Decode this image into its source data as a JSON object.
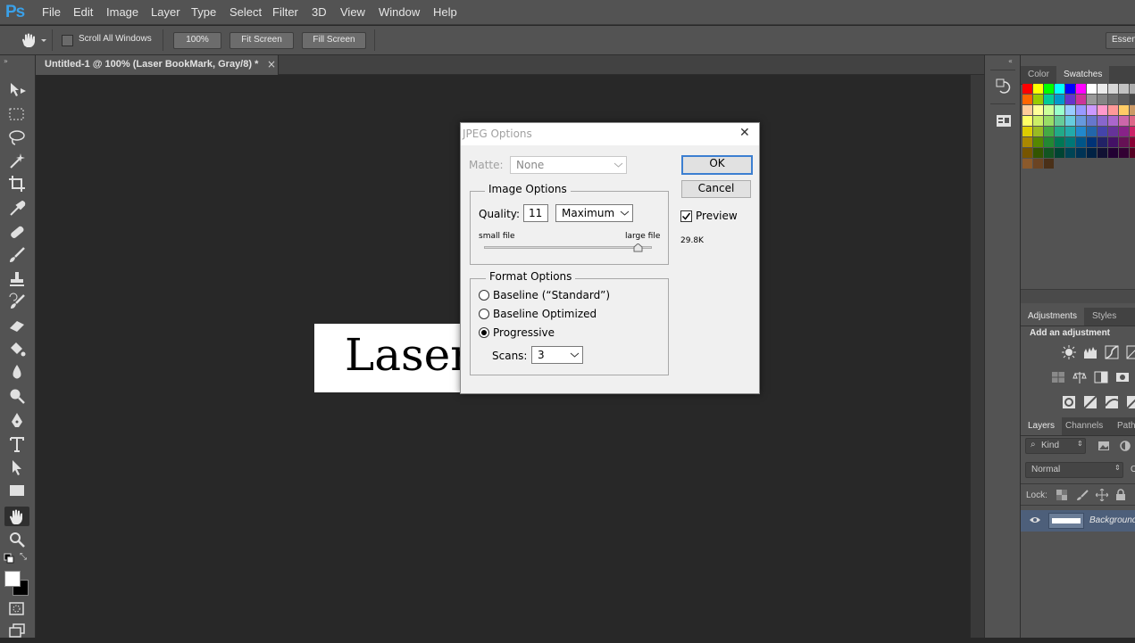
{
  "app": {
    "logo": "Ps"
  },
  "menu": [
    "File",
    "Edit",
    "Image",
    "Layer",
    "Type",
    "Select",
    "Filter",
    "3D",
    "View",
    "Window",
    "Help"
  ],
  "options_bar": {
    "scroll_all_windows": "Scroll All Windows",
    "zoom_100": "100%",
    "fit_screen": "Fit Screen",
    "fill_screen": "Fill Screen",
    "workspace": "Essen"
  },
  "document_tab": {
    "title": "Untitled-1 @ 100% (Laser BookMark, Gray/8) *",
    "close": "×"
  },
  "canvas": {
    "text": "Laser"
  },
  "dialog": {
    "title": "JPEG Options",
    "close": "✕",
    "matte_label": "Matte:",
    "matte_value": "None",
    "ok": "OK",
    "cancel": "Cancel",
    "preview_label": "Preview",
    "preview_checked": true,
    "file_size": "29.8K",
    "image_options": {
      "title": "Image Options",
      "quality_label": "Quality:",
      "quality_value": "11",
      "quality_preset": "Maximum",
      "small_file": "small file",
      "large_file": "large file",
      "slider_level": 0.917
    },
    "format_options": {
      "title": "Format Options",
      "options": [
        "Baseline (“Standard”)",
        "Baseline Optimized",
        "Progressive"
      ],
      "selected": "Progressive",
      "scans_label": "Scans:",
      "scans_value": "3"
    }
  },
  "panels": {
    "color_tabs": [
      "Color",
      "Swatches"
    ],
    "adjustments_tabs": [
      "Adjustments",
      "Styles"
    ],
    "adjustments_hint": "Add an adjustment",
    "layers_tabs": [
      "Layers",
      "Channels",
      "Paths"
    ],
    "kind_filter": "Kind",
    "blend_mode": "Normal",
    "opacity_label": "O",
    "lock_label": "Lock:",
    "layer_name": "Background"
  },
  "colors": {
    "swatches_row1": [
      "#ff0000",
      "#ffff00",
      "#00ff00",
      "#00ffff",
      "#0000ff",
      "#ff00ff",
      "#ffffff",
      "#ebebeb",
      "#d6d6d6",
      "#c2c2c2",
      "#adadad"
    ],
    "swatches_row2": [
      "#ff6600",
      "#99cc00",
      "#00cc99",
      "#0099cc",
      "#6633cc",
      "#cc3399",
      "#999999",
      "#858585",
      "#707070",
      "#5c5c5c",
      "#474747"
    ],
    "swatches_row3": [
      "#ffcc99",
      "#ffff99",
      "#ccff99",
      "#99ffcc",
      "#99ccff",
      "#9999ff",
      "#cc99ff",
      "#ff99cc",
      "#ff9999",
      "#ffcc66",
      "#cc9966"
    ],
    "swatches_row4": [
      "#ffff66",
      "#ccee66",
      "#99dd66",
      "#66cc99",
      "#66ccdd",
      "#6699dd",
      "#6677cc",
      "#8866cc",
      "#aa66cc",
      "#cc66aa",
      "#dd6688"
    ],
    "swatches_row5": [
      "#ddcc00",
      "#99bb22",
      "#44aa44",
      "#22aa88",
      "#22aaaa",
      "#2288cc",
      "#2266aa",
      "#4444aa",
      "#663399",
      "#882288",
      "#cc2266"
    ],
    "swatches_row6": [
      "#aa8800",
      "#558800",
      "#228833",
      "#007755",
      "#007777",
      "#005588",
      "#003377",
      "#222266",
      "#441166",
      "#661155",
      "#880033"
    ],
    "swatches_row7": [
      "#775500",
      "#335500",
      "#115522",
      "#004433",
      "#004455",
      "#003355",
      "#002244",
      "#111133",
      "#220033",
      "#330033",
      "#550022"
    ],
    "swatches_row8": [
      "#8b5a2b",
      "#6b4423",
      "#4a3018"
    ]
  }
}
